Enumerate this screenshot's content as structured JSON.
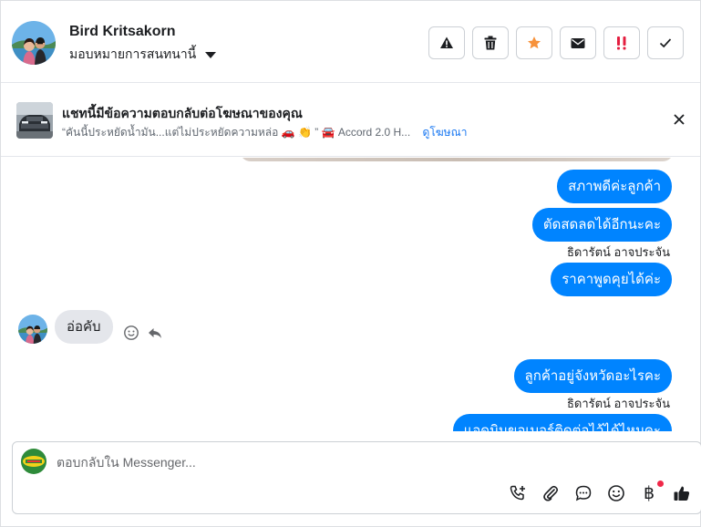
{
  "header": {
    "contact_name": "Bird Kritsakorn",
    "assign_label": "มอบหมายการสนทนานี้",
    "actions": [
      {
        "name": "mark-spam-button",
        "icon": "warning-icon"
      },
      {
        "name": "delete-button",
        "icon": "trash-icon"
      },
      {
        "name": "star-button",
        "icon": "star-icon",
        "color": "#f7923b"
      },
      {
        "name": "move-to-inbox-button",
        "icon": "envelope-icon"
      },
      {
        "name": "follow-up-button",
        "icon": "exclamation-icon",
        "color": "#e41e3f"
      },
      {
        "name": "mark-done-button",
        "icon": "check-icon"
      }
    ]
  },
  "ad_banner": {
    "title": "แชทนี้มีข้อความตอบกลับต่อโฆษณาของคุณ",
    "snippet": "“คันนี้ประหยัดน้ำมัน...แต่ไม่ประหยัดความหล่อ 🚗 👏 ” 🚘 Accord 2.0 H...",
    "link": "ดูโฆษณา"
  },
  "messages": {
    "out_1": "สภาพดีค่ะลูกค้า",
    "out_2": "ตัดสดลดได้อีกนะคะ",
    "sender_1": "ธิดารัตน์ อาจประจัน",
    "out_3": "ราคาพูดคุยได้ค่ะ",
    "in_1": "อ่อคับ",
    "out_4": "ลูกค้าอยู่จังหวัดอะไรคะ",
    "sender_2": "ธิดารัตน์ อาจประจัน",
    "out_5_partial": "แอดมินขอเบอร์ติดต่อไว้ได้ไหมคะ"
  },
  "composer": {
    "placeholder": "ตอบกลับใน Messenger...",
    "icons": [
      "call-add-icon",
      "attachment-icon",
      "saved-reply-icon",
      "emoji-icon",
      "payment-baht-icon",
      "thumbs-up-icon"
    ]
  },
  "colors": {
    "accent": "#0084ff",
    "link": "#1877f2",
    "incoming_bubble": "#e4e6eb",
    "notification_dot": "#f02849"
  }
}
